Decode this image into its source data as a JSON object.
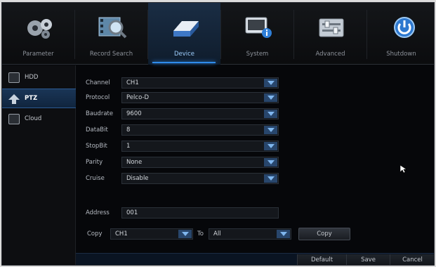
{
  "nav": {
    "items": [
      {
        "label": "Parameter",
        "icon": "gears-icon"
      },
      {
        "label": "Record Search",
        "icon": "magnifier-film-icon"
      },
      {
        "label": "Device",
        "icon": "hard-drive-icon"
      },
      {
        "label": "System",
        "icon": "monitor-info-icon"
      },
      {
        "label": "Advanced",
        "icon": "sliders-icon"
      },
      {
        "label": "Shutdown",
        "icon": "power-icon"
      }
    ],
    "active": "Device"
  },
  "sidebar": {
    "items": [
      {
        "label": "HDD"
      },
      {
        "label": "PTZ"
      },
      {
        "label": "Cloud"
      }
    ],
    "active": "PTZ"
  },
  "form": {
    "channel": {
      "label": "Channel",
      "value": "CH1"
    },
    "protocol": {
      "label": "Protocol",
      "value": "Pelco-D"
    },
    "baudrate": {
      "label": "Baudrate",
      "value": "9600"
    },
    "databit": {
      "label": "DataBit",
      "value": "8"
    },
    "stopbit": {
      "label": "StopBit",
      "value": "1"
    },
    "parity": {
      "label": "Parity",
      "value": "None"
    },
    "cruise": {
      "label": "Cruise",
      "value": "Disable"
    },
    "address": {
      "label": "Address",
      "value": "001"
    },
    "copy": {
      "label": "Copy",
      "from_value": "CH1",
      "to_label": "To",
      "to_value": "All",
      "button": "Copy"
    }
  },
  "footer": {
    "default": "Default",
    "save": "Save",
    "cancel": "Cancel"
  },
  "colors": {
    "accent": "#2f8bea",
    "background": "#06070a"
  }
}
